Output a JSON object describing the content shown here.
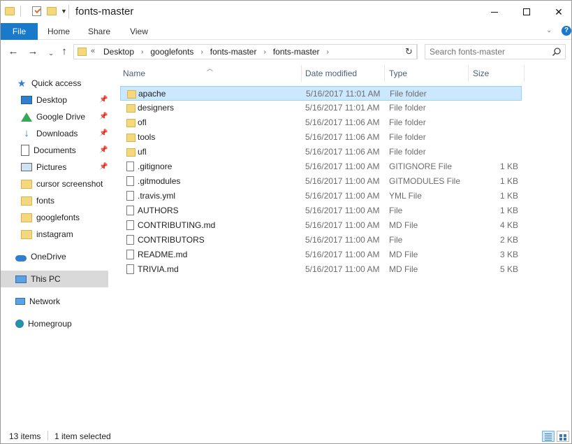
{
  "window": {
    "title": "fonts-master",
    "minimize": "minimize",
    "maximize": "maximize",
    "close": "✕"
  },
  "ribbon": {
    "tabs": [
      {
        "label": "File"
      },
      {
        "label": "Home"
      },
      {
        "label": "Share"
      },
      {
        "label": "View"
      }
    ],
    "help": "?"
  },
  "address": {
    "overflow": "«",
    "crumbs": [
      "Desktop",
      "googlefonts",
      "fonts-master",
      "fonts-master"
    ],
    "search_placeholder": "Search fonts-master"
  },
  "nav_pane": {
    "items": [
      {
        "label": "Quick access",
        "icon": "star-icon"
      },
      {
        "label": "Desktop",
        "icon": "desktop-icon",
        "pinned": true
      },
      {
        "label": "Google Drive",
        "icon": "google-drive-icon",
        "pinned": true
      },
      {
        "label": "Downloads",
        "icon": "download-icon",
        "pinned": true
      },
      {
        "label": "Documents",
        "icon": "documents-icon",
        "pinned": true
      },
      {
        "label": "Pictures",
        "icon": "pictures-icon",
        "pinned": true
      },
      {
        "label": "cursor screenshot",
        "icon": "folder-icon"
      },
      {
        "label": "fonts",
        "icon": "folder-icon"
      },
      {
        "label": "googlefonts",
        "icon": "folder-icon"
      },
      {
        "label": "instagram",
        "icon": "folder-icon"
      },
      {
        "label": "OneDrive",
        "icon": "onedrive-icon"
      },
      {
        "label": "This PC",
        "icon": "computer-icon",
        "selected": true
      },
      {
        "label": "Network",
        "icon": "network-icon"
      },
      {
        "label": "Homegroup",
        "icon": "homegroup-icon"
      }
    ]
  },
  "columns": {
    "name": "Name",
    "date": "Date modified",
    "type": "Type",
    "size": "Size"
  },
  "files": [
    {
      "name": "apache",
      "date": "5/16/2017 11:01 AM",
      "type": "File folder",
      "size": "",
      "kind": "folder",
      "selected": true
    },
    {
      "name": "designers",
      "date": "5/16/2017 11:01 AM",
      "type": "File folder",
      "size": "",
      "kind": "folder"
    },
    {
      "name": "ofl",
      "date": "5/16/2017 11:06 AM",
      "type": "File folder",
      "size": "",
      "kind": "folder"
    },
    {
      "name": "tools",
      "date": "5/16/2017 11:06 AM",
      "type": "File folder",
      "size": "",
      "kind": "folder"
    },
    {
      "name": "ufl",
      "date": "5/16/2017 11:06 AM",
      "type": "File folder",
      "size": "",
      "kind": "folder"
    },
    {
      "name": ".gitignore",
      "date": "5/16/2017 11:00 AM",
      "type": "GITIGNORE File",
      "size": "1 KB",
      "kind": "file"
    },
    {
      "name": ".gitmodules",
      "date": "5/16/2017 11:00 AM",
      "type": "GITMODULES File",
      "size": "1 KB",
      "kind": "file"
    },
    {
      "name": ".travis.yml",
      "date": "5/16/2017 11:00 AM",
      "type": "YML File",
      "size": "1 KB",
      "kind": "file"
    },
    {
      "name": "AUTHORS",
      "date": "5/16/2017 11:00 AM",
      "type": "File",
      "size": "1 KB",
      "kind": "file"
    },
    {
      "name": "CONTRIBUTING.md",
      "date": "5/16/2017 11:00 AM",
      "type": "MD File",
      "size": "4 KB",
      "kind": "file"
    },
    {
      "name": "CONTRIBUTORS",
      "date": "5/16/2017 11:00 AM",
      "type": "File",
      "size": "2 KB",
      "kind": "file"
    },
    {
      "name": "README.md",
      "date": "5/16/2017 11:00 AM",
      "type": "MD File",
      "size": "3 KB",
      "kind": "file"
    },
    {
      "name": "TRIVIA.md",
      "date": "5/16/2017 11:00 AM",
      "type": "MD File",
      "size": "5 KB",
      "kind": "file"
    }
  ],
  "status": {
    "count": "13 items",
    "selection": "1 item selected"
  },
  "colors": {
    "accent": "#1979ca",
    "selection_bg": "#cce8ff",
    "selection_border": "#99d1ff",
    "folder": "#f5d77d"
  }
}
